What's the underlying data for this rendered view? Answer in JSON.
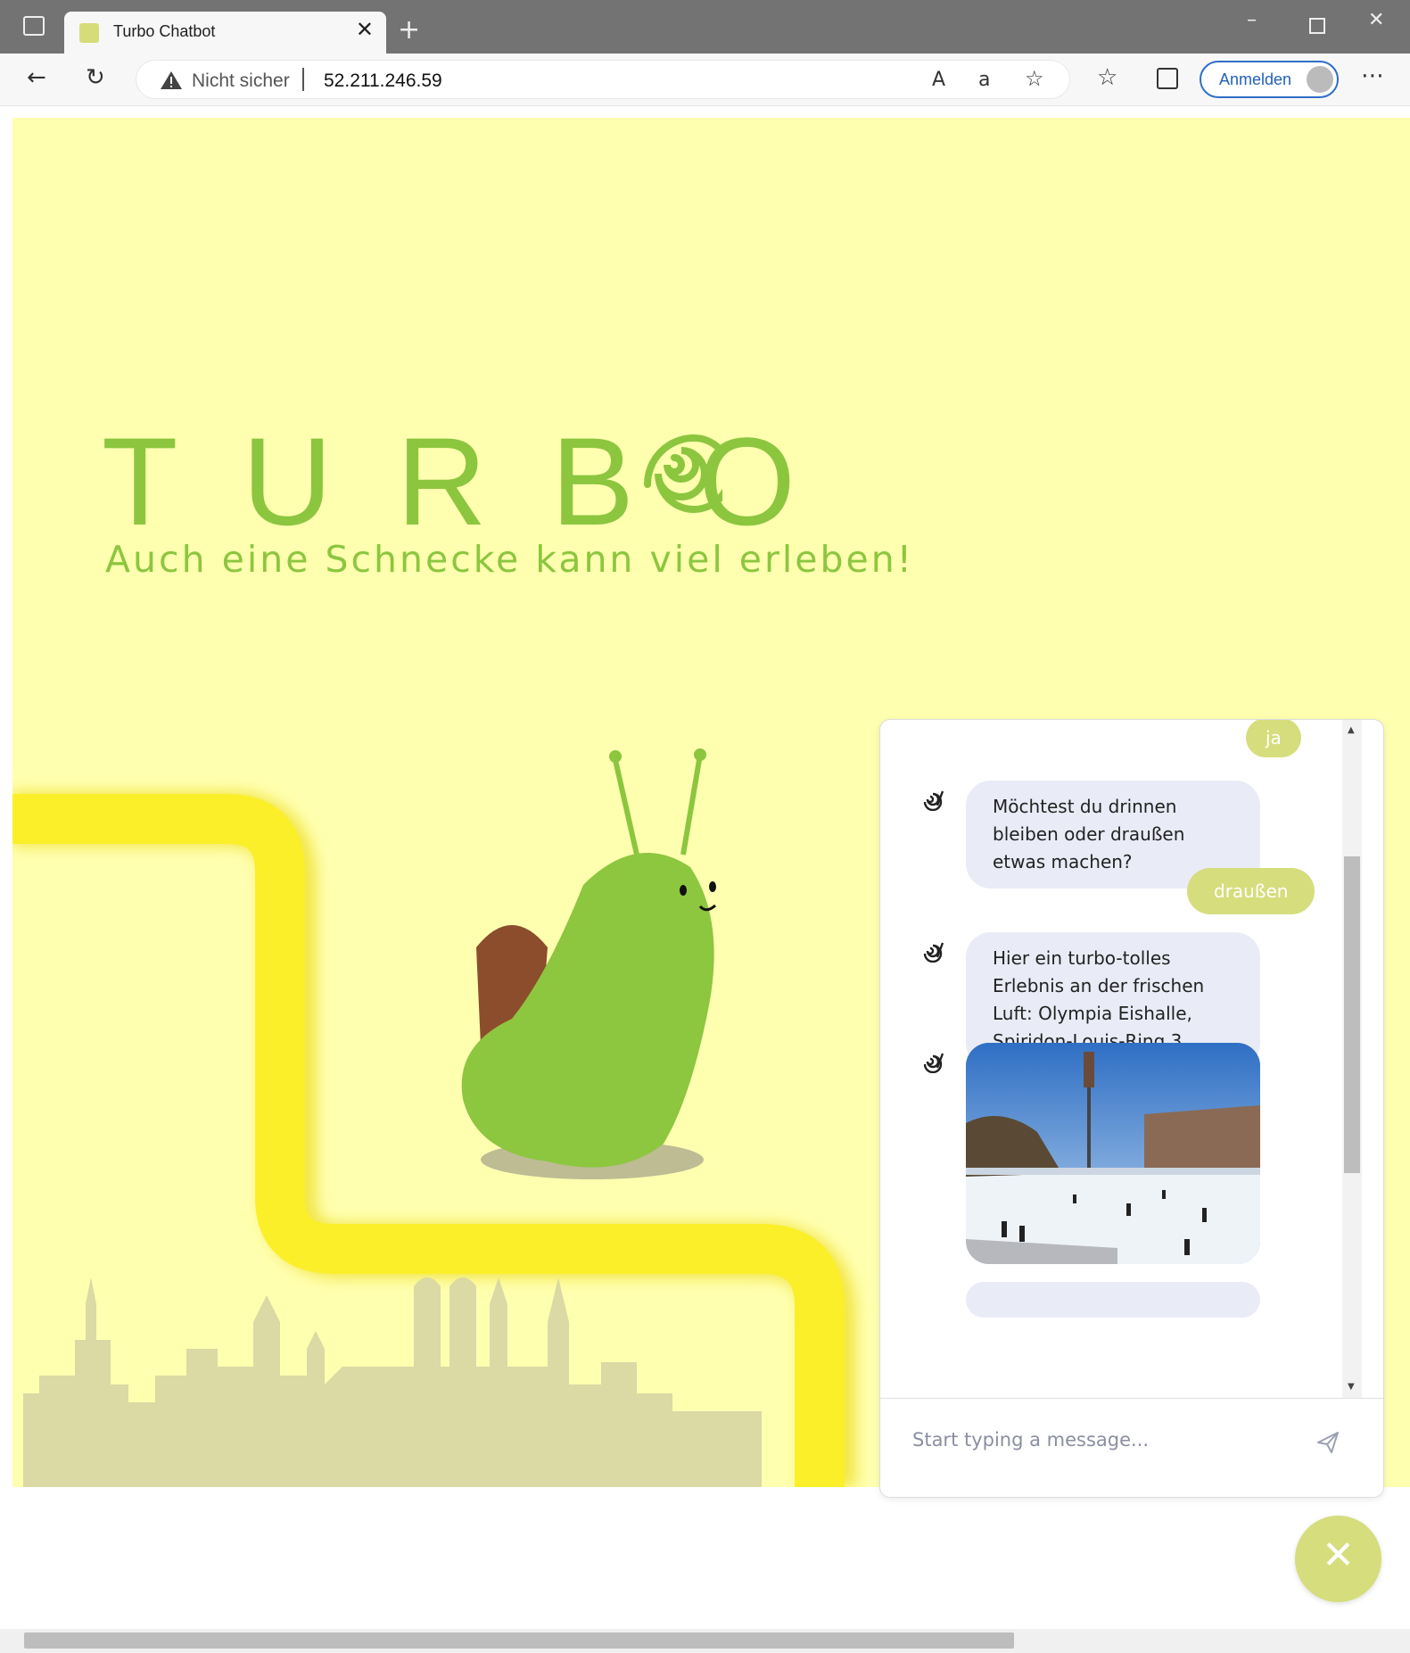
{
  "browser": {
    "tab_title": "Turbo Chatbot",
    "security_label": "Nicht sicher",
    "url": "52.211.246.59",
    "signin_label": "Anmelden"
  },
  "hero": {
    "title": "TURBO",
    "tagline": "Auch eine Schnecke kann viel erleben!"
  },
  "chat": {
    "messages": [
      {
        "from": "user",
        "text": "ja"
      },
      {
        "from": "bot",
        "text": "Möchtest du drinnen bleiben oder draußen etwas machen?"
      },
      {
        "from": "user",
        "text": "draußen"
      },
      {
        "from": "bot",
        "text": "Hier ein turbo-tolles Erlebnis an der frischen Luft: Olympia Eishalle, Spiridon-Louis-Ring 3"
      },
      {
        "from": "bot",
        "type": "image",
        "image": "ice-rink-photo"
      }
    ],
    "input_placeholder": "Start typing a message...",
    "close_icon": "close-icon"
  },
  "colors": {
    "page_bg": "#ffffb0",
    "brand_green": "#8cc63f",
    "bubble_user": "#d6dd7c",
    "bubble_bot": "#e9ecf6"
  }
}
